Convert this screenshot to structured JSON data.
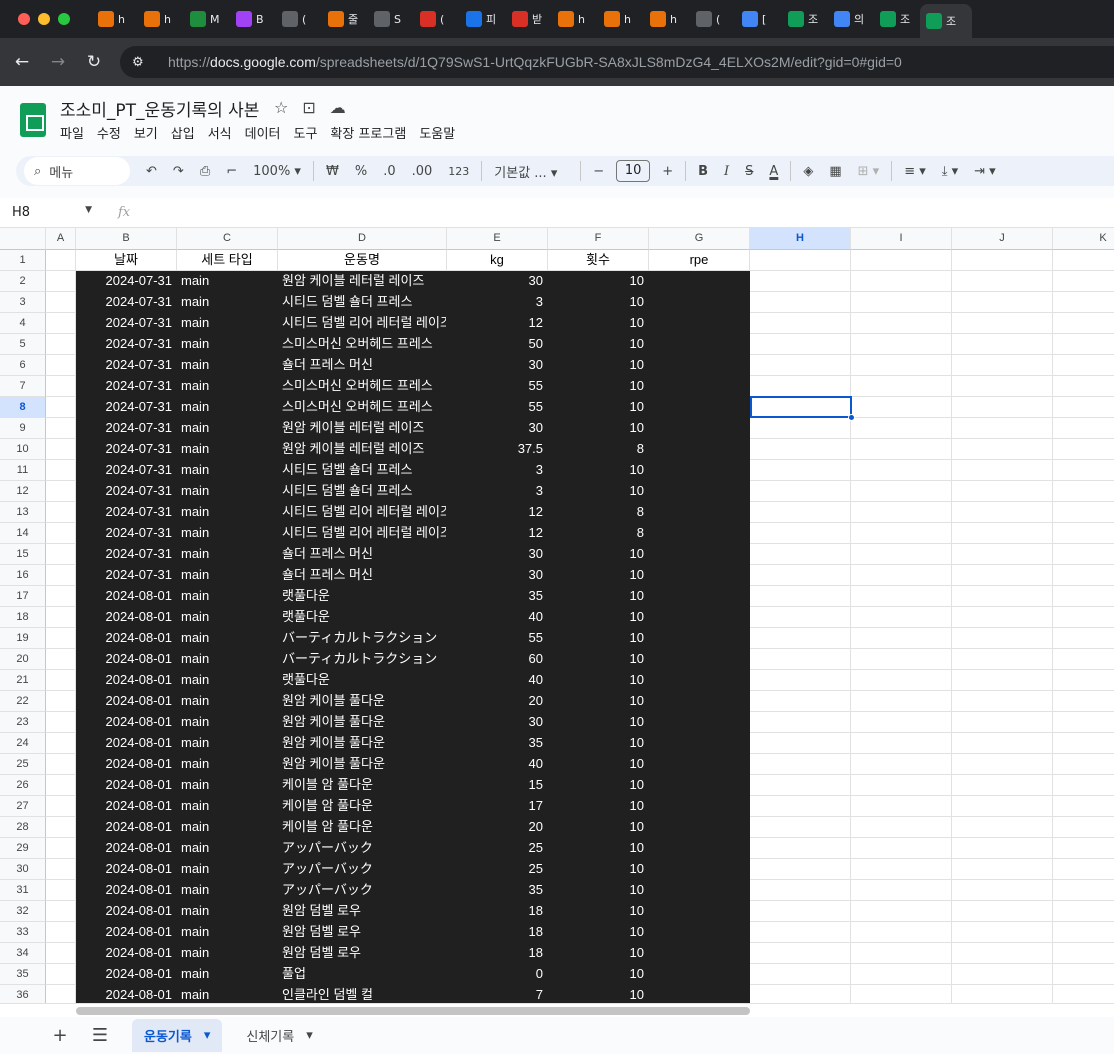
{
  "browser": {
    "tabs": [
      {
        "label": "h",
        "color": "#e8710a"
      },
      {
        "label": "h",
        "color": "#e8710a"
      },
      {
        "label": "M",
        "color": "#1e8e3e"
      },
      {
        "label": "B",
        "color": "#a142f4"
      },
      {
        "label": "(",
        "color": "#5f6368"
      },
      {
        "label": "줄",
        "color": "#e8710a"
      },
      {
        "label": "S",
        "color": "#5f6368"
      },
      {
        "label": "(",
        "color": "#d93025"
      },
      {
        "label": "피",
        "color": "#1a73e8"
      },
      {
        "label": "받",
        "color": "#d93025"
      },
      {
        "label": "h",
        "color": "#e8710a"
      },
      {
        "label": "h",
        "color": "#e8710a"
      },
      {
        "label": "h",
        "color": "#e8710a"
      },
      {
        "label": "(",
        "color": "#5f6368"
      },
      {
        "label": "[",
        "color": "#4285f4"
      },
      {
        "label": "조",
        "color": "#0f9d58"
      },
      {
        "label": "의",
        "color": "#4285f4"
      },
      {
        "label": "조",
        "color": "#0f9d58"
      },
      {
        "label": "조",
        "color": "#0f9d58"
      }
    ],
    "url_scheme": "https://",
    "url_host": "docs.google.com",
    "url_path": "/spreadsheets/d/1Q79SwS1-UrtQqzkFUGbR-SA8xJLS8mDzG4_4ELXOs2M/edit?gid=0#gid=0"
  },
  "doc": {
    "title": "조소미_PT_운동기록의 사본",
    "menu": [
      "파일",
      "수정",
      "보기",
      "삽입",
      "서식",
      "데이터",
      "도구",
      "확장 프로그램",
      "도움말"
    ]
  },
  "toolbar": {
    "search": "메뉴",
    "zoom": "100%",
    "currency": "₩",
    "percent": "%",
    "dec_less": ".0",
    "dec_more": ".00",
    "number_format": "123",
    "font": "기본값 ...",
    "font_size": "10",
    "bold": "B",
    "italic": "I",
    "strike": "S",
    "text_color": "A"
  },
  "formula_bar": {
    "cell_ref": "H8",
    "fx": "fx"
  },
  "grid": {
    "columns": [
      "A",
      "B",
      "C",
      "D",
      "E",
      "F",
      "G",
      "H",
      "I",
      "J",
      "K"
    ],
    "selected_column": "H",
    "selected_row": 8,
    "header": [
      "",
      "날짜",
      "세트 타입",
      "운동명",
      "kg",
      "횟수",
      "rpe"
    ],
    "rows": [
      [
        "2024-07-31",
        "main",
        "원암 케이블 레터럴 레이즈",
        "30",
        "10"
      ],
      [
        "2024-07-31",
        "main",
        "시티드 덤벨 숄더 프레스",
        "3",
        "10"
      ],
      [
        "2024-07-31",
        "main",
        "시티드 덤벨 리어 레터럴 레이즈",
        "12",
        "10"
      ],
      [
        "2024-07-31",
        "main",
        "스미스머신 오버헤드 프레스",
        "50",
        "10"
      ],
      [
        "2024-07-31",
        "main",
        "숄더 프레스 머신",
        "30",
        "10"
      ],
      [
        "2024-07-31",
        "main",
        "스미스머신 오버헤드 프레스",
        "55",
        "10"
      ],
      [
        "2024-07-31",
        "main",
        "스미스머신 오버헤드 프레스",
        "55",
        "10"
      ],
      [
        "2024-07-31",
        "main",
        "원암 케이블 레터럴 레이즈",
        "30",
        "10"
      ],
      [
        "2024-07-31",
        "main",
        "원암 케이블 레터럴 레이즈",
        "37.5",
        "8"
      ],
      [
        "2024-07-31",
        "main",
        "시티드 덤벨 숄더 프레스",
        "3",
        "10"
      ],
      [
        "2024-07-31",
        "main",
        "시티드 덤벨 숄더 프레스",
        "3",
        "10"
      ],
      [
        "2024-07-31",
        "main",
        "시티드 덤벨 리어 레터럴 레이즈",
        "12",
        "8"
      ],
      [
        "2024-07-31",
        "main",
        "시티드 덤벨 리어 레터럴 레이즈",
        "12",
        "8"
      ],
      [
        "2024-07-31",
        "main",
        "숄더 프레스 머신",
        "30",
        "10"
      ],
      [
        "2024-07-31",
        "main",
        "숄더 프레스 머신",
        "30",
        "10"
      ],
      [
        "2024-08-01",
        "main",
        "랫풀다운",
        "35",
        "10"
      ],
      [
        "2024-08-01",
        "main",
        "랫풀다운",
        "40",
        "10"
      ],
      [
        "2024-08-01",
        "main",
        "バーティカルトラクション",
        "55",
        "10"
      ],
      [
        "2024-08-01",
        "main",
        "バーティカルトラクション",
        "60",
        "10"
      ],
      [
        "2024-08-01",
        "main",
        "랫풀다운",
        "40",
        "10"
      ],
      [
        "2024-08-01",
        "main",
        "원암 케이블 풀다운",
        "20",
        "10"
      ],
      [
        "2024-08-01",
        "main",
        "원암 케이블 풀다운",
        "30",
        "10"
      ],
      [
        "2024-08-01",
        "main",
        "원암 케이블 풀다운",
        "35",
        "10"
      ],
      [
        "2024-08-01",
        "main",
        "원암 케이블 풀다운",
        "40",
        "10"
      ],
      [
        "2024-08-01",
        "main",
        "케이블 암 풀다운",
        "15",
        "10"
      ],
      [
        "2024-08-01",
        "main",
        "케이블 암 풀다운",
        "17",
        "10"
      ],
      [
        "2024-08-01",
        "main",
        "케이블 암 풀다운",
        "20",
        "10"
      ],
      [
        "2024-08-01",
        "main",
        "アッパーバック",
        "25",
        "10"
      ],
      [
        "2024-08-01",
        "main",
        "アッパーバック",
        "25",
        "10"
      ],
      [
        "2024-08-01",
        "main",
        "アッパーバック",
        "35",
        "10"
      ],
      [
        "2024-08-01",
        "main",
        "원암 덤벨 로우",
        "18",
        "10"
      ],
      [
        "2024-08-01",
        "main",
        "원암 덤벨 로우",
        "18",
        "10"
      ],
      [
        "2024-08-01",
        "main",
        "원암 덤벨 로우",
        "18",
        "10"
      ],
      [
        "2024-08-01",
        "main",
        "풀업",
        "0",
        "10"
      ],
      [
        "2024-08-01",
        "main",
        "인클라인 덤벨 컬",
        "7",
        "10"
      ]
    ]
  },
  "sheets": {
    "add": "+",
    "list": "☰",
    "tabs": [
      {
        "label": "운동기록",
        "active": true
      },
      {
        "label": "신체기록",
        "active": false
      }
    ]
  }
}
